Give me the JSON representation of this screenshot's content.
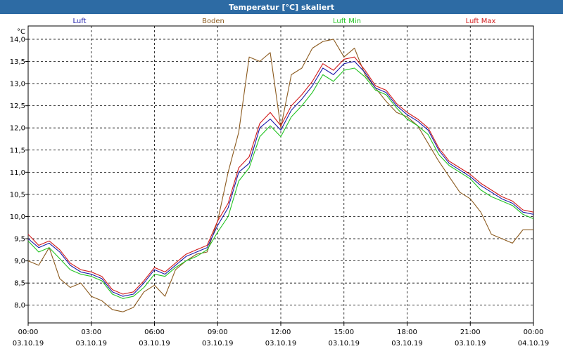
{
  "window": {
    "title": "Temperatur [°C] skaliert"
  },
  "chart_data": {
    "type": "line",
    "title": "Temperatur [°C] skaliert",
    "ylabel": "°C",
    "ylim": [
      7.6,
      14.3
    ],
    "xlim": [
      "03.10.19 00:00",
      "04.10.19 00:00"
    ],
    "grid": true,
    "legend": "top",
    "y_ticks": [
      "14,0",
      "13,5",
      "13,0",
      "12,5",
      "12,0",
      "11,5",
      "11,0",
      "10,5",
      "10,0",
      "9,5",
      "9,0",
      "8,5",
      "8,0"
    ],
    "x_ticks": [
      {
        "time": "00:00",
        "date": "03.10.19"
      },
      {
        "time": "03:00",
        "date": "03.10.19"
      },
      {
        "time": "06:00",
        "date": "03.10.19"
      },
      {
        "time": "09:00",
        "date": "03.10.19"
      },
      {
        "time": "12:00",
        "date": "03.10.19"
      },
      {
        "time": "15:00",
        "date": "03.10.19"
      },
      {
        "time": "18:00",
        "date": "03.10.19"
      },
      {
        "time": "21:00",
        "date": "03.10.19"
      },
      {
        "time": "00:00",
        "date": "04.10.19"
      }
    ],
    "x_hours": [
      0,
      0.5,
      1,
      1.5,
      2,
      2.5,
      3,
      3.5,
      4,
      4.5,
      5,
      5.5,
      6,
      6.5,
      7,
      7.5,
      8,
      8.5,
      9,
      9.5,
      10,
      10.5,
      11,
      11.5,
      12,
      12.5,
      13,
      13.5,
      14,
      14.5,
      15,
      15.5,
      16,
      16.5,
      17,
      17.5,
      18,
      18.5,
      19,
      19.5,
      20,
      20.5,
      21,
      21.5,
      22,
      22.5,
      23,
      23.5,
      24
    ],
    "series": [
      {
        "name": "Luft",
        "color": "#1a1aa8",
        "values": [
          9.5,
          9.3,
          9.4,
          9.2,
          8.9,
          8.75,
          8.7,
          8.6,
          8.3,
          8.2,
          8.25,
          8.5,
          8.8,
          8.7,
          8.9,
          9.1,
          9.2,
          9.3,
          9.8,
          10.2,
          11.0,
          11.2,
          12.0,
          12.2,
          11.95,
          12.4,
          12.65,
          12.95,
          13.35,
          13.2,
          13.45,
          13.5,
          13.25,
          12.9,
          12.8,
          12.5,
          12.3,
          12.15,
          11.95,
          11.5,
          11.2,
          11.05,
          10.9,
          10.7,
          10.55,
          10.4,
          10.3,
          10.1,
          10.05
        ]
      },
      {
        "name": "Boden",
        "color": "#8b5a1e",
        "values": [
          9.0,
          8.9,
          9.3,
          8.6,
          8.4,
          8.5,
          8.2,
          8.1,
          7.9,
          7.85,
          7.95,
          8.3,
          8.45,
          8.2,
          8.8,
          9.0,
          9.15,
          9.2,
          9.9,
          11.0,
          11.9,
          13.6,
          13.5,
          13.7,
          12.0,
          13.2,
          13.35,
          13.8,
          13.95,
          14.0,
          13.6,
          13.8,
          13.2,
          12.9,
          12.6,
          12.35,
          12.25,
          12.05,
          11.65,
          11.25,
          10.9,
          10.55,
          10.4,
          10.1,
          9.6,
          9.5,
          9.4,
          9.7,
          9.7
        ]
      },
      {
        "name": "Luft Min",
        "color": "#22c322",
        "values": [
          9.45,
          9.2,
          9.3,
          9.05,
          8.8,
          8.7,
          8.65,
          8.55,
          8.25,
          8.15,
          8.2,
          8.4,
          8.7,
          8.65,
          8.85,
          9.0,
          9.1,
          9.25,
          9.65,
          10.0,
          10.8,
          11.1,
          11.8,
          12.05,
          11.8,
          12.25,
          12.5,
          12.8,
          13.2,
          13.05,
          13.3,
          13.35,
          13.15,
          12.85,
          12.75,
          12.45,
          12.2,
          12.05,
          11.85,
          11.4,
          11.15,
          11.0,
          10.85,
          10.6,
          10.45,
          10.35,
          10.25,
          10.05,
          9.95
        ]
      },
      {
        "name": "Luft Max",
        "color": "#d11a1a",
        "values": [
          9.6,
          9.35,
          9.45,
          9.25,
          8.95,
          8.8,
          8.75,
          8.65,
          8.35,
          8.25,
          8.3,
          8.55,
          8.85,
          8.75,
          8.95,
          9.15,
          9.25,
          9.35,
          9.9,
          10.3,
          11.1,
          11.35,
          12.1,
          12.35,
          12.05,
          12.5,
          12.75,
          13.05,
          13.45,
          13.3,
          13.55,
          13.6,
          13.3,
          12.95,
          12.85,
          12.55,
          12.35,
          12.2,
          12.0,
          11.55,
          11.25,
          11.1,
          10.95,
          10.75,
          10.6,
          10.45,
          10.35,
          10.15,
          10.1
        ]
      }
    ]
  }
}
